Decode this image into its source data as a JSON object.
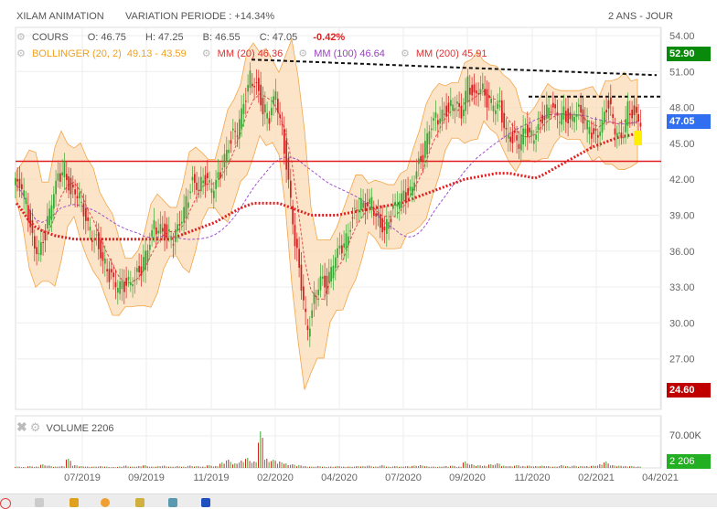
{
  "header": {
    "title": "XILAM ANIMATION",
    "variation": "VARIATION PERIODE : +14.34%",
    "period": "2 ANS - JOUR"
  },
  "legend": {
    "cours": "COURS",
    "open": "O: 46.75",
    "high": "H: 47.25",
    "low": "B: 46.55",
    "close": "C: 47.05",
    "change": "-0.42%",
    "bollinger": "BOLLINGER (20, 2)",
    "bollinger_vals": "49.13 - 43.59",
    "mm20": "MM (20)",
    "mm20_val": "46.36",
    "mm100": "MM (100)",
    "mm100_val": "46.64",
    "mm200": "MM (200)",
    "mm200_val": "45.91"
  },
  "volume_panel": {
    "label": "VOLUME",
    "value": "2206",
    "axis_label": "70.00K",
    "badge": "2 206"
  },
  "badges": {
    "high": "52.90",
    "last": "47.05",
    "low": "24.60"
  },
  "colors": {
    "up": "#3aa635",
    "down": "#d42020",
    "band": "#fbd9b0",
    "bandLine": "#f2a64a",
    "mm20": "#e05050",
    "mm100": "#a050d0",
    "mm200": "#e02020",
    "support": "#e02020"
  },
  "chart_data": {
    "type": "candlestick",
    "title": "XILAM ANIMATION",
    "y_ticks": [
      "54.00",
      "51.00",
      "48.00",
      "45.00",
      "42.00",
      "39.00",
      "36.00",
      "33.00",
      "30.00",
      "27.00"
    ],
    "ylim": [
      24,
      54.5
    ],
    "x_ticks": [
      "07/2019",
      "09/2019",
      "11/2019",
      "02/2020",
      "04/2020",
      "07/2020",
      "09/2020",
      "11/2020",
      "02/2021",
      "04/2021"
    ],
    "weekly_close": [
      41.5,
      40,
      37,
      36,
      37.5,
      40,
      42,
      43,
      41,
      41,
      39,
      37.5,
      37,
      35.5,
      34,
      33,
      33,
      33.5,
      34,
      34.5,
      36,
      38,
      38,
      37.5,
      37,
      38,
      40,
      42,
      41.5,
      42,
      41,
      42,
      44,
      45.5,
      46,
      48,
      50.5,
      50,
      48,
      47,
      49,
      46,
      42,
      37,
      33,
      29,
      32,
      34,
      33,
      35,
      36,
      37,
      39,
      40,
      39.5,
      40,
      38.5,
      38,
      39,
      40,
      40.5,
      41,
      43,
      44,
      46,
      47,
      47.5,
      48,
      48.5,
      47,
      50,
      49,
      50,
      48.5,
      48,
      48,
      46,
      45.5,
      45,
      46,
      45.5,
      46.5,
      47.5,
      48,
      47,
      47.5,
      47,
      48,
      47,
      46,
      45.5,
      47,
      48.5,
      46,
      45,
      48,
      47.5,
      47
    ],
    "mm200": [
      40,
      39.3,
      38.5,
      38,
      37.7,
      37.5,
      37.3,
      37.2,
      37.1,
      37,
      37,
      37,
      37,
      37,
      37,
      37,
      37,
      37,
      37,
      37,
      37,
      37,
      37,
      37,
      37,
      37.2,
      37.4,
      37.6,
      37.8,
      38,
      38.2,
      38.4,
      38.7,
      39,
      39.3,
      39.6,
      39.8,
      40,
      40,
      40,
      40,
      40,
      39.8,
      39.6,
      39.4,
      39.2,
      39,
      39,
      39,
      39,
      39,
      39.1,
      39.2,
      39.3,
      39.4,
      39.5,
      39.6,
      39.7,
      39.8,
      39.9,
      40,
      40.2,
      40.4,
      40.6,
      40.8,
      41,
      41.2,
      41.4,
      41.6,
      41.8,
      42,
      42.1,
      42.2,
      42.3,
      42.4,
      42.5,
      42.5,
      42.5,
      42.4,
      42.3,
      42.2,
      42.1,
      42.3,
      42.6,
      42.9,
      43.2,
      43.5,
      43.8,
      44.1,
      44.4,
      44.7,
      44.9,
      45.1,
      45.3,
      45.5,
      45.6,
      45.7,
      45.9
    ],
    "support_level": 43.5,
    "resistance_lines": [
      {
        "from": 52.0,
        "to": 50.7
      },
      {
        "from": 48.9,
        "to": 48.9
      }
    ],
    "volume_k": [
      3,
      2,
      4,
      3,
      8,
      5,
      3,
      4,
      20,
      6,
      4,
      3,
      3,
      4,
      3,
      2,
      3,
      5,
      3,
      4,
      6,
      3,
      4,
      5,
      3,
      4,
      3,
      5,
      4,
      3,
      6,
      4,
      12,
      18,
      10,
      16,
      22,
      14,
      80,
      20,
      18,
      14,
      10,
      8,
      6,
      4,
      3,
      4,
      3,
      3,
      4,
      3,
      3,
      4,
      4,
      5,
      3,
      6,
      3,
      4,
      3,
      4,
      5,
      6,
      4,
      3,
      3,
      4,
      5,
      3,
      14,
      8,
      6,
      5,
      8,
      10,
      5,
      4,
      6,
      4,
      5,
      4,
      5,
      4,
      3,
      6,
      4,
      5,
      4,
      4,
      5,
      8,
      14,
      6,
      5,
      4,
      4,
      3
    ],
    "volume_ylim": [
      0,
      70
    ]
  }
}
